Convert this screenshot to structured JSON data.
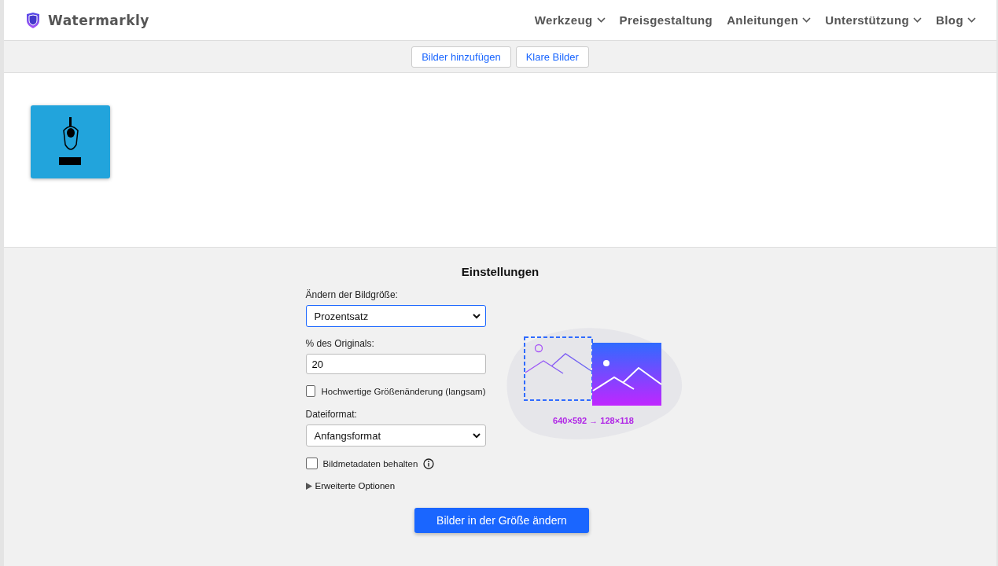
{
  "header": {
    "brand": "Watermarkly",
    "nav": [
      {
        "label": "Werkzeug",
        "dropdown": true
      },
      {
        "label": "Preisgestaltung",
        "dropdown": false
      },
      {
        "label": "Anleitungen",
        "dropdown": true
      },
      {
        "label": "Unterstützung",
        "dropdown": true
      },
      {
        "label": "Blog",
        "dropdown": true
      }
    ]
  },
  "toolbar": {
    "buttons": [
      "Bilder hinzufügen",
      "Klare Bilder"
    ]
  },
  "settings": {
    "title": "Einstellungen",
    "fields": [
      {
        "kind": "select",
        "label": "Ändern der Bildgröße:",
        "value": "Prozentsatz",
        "focused": true
      },
      {
        "kind": "input",
        "label": "% des Originals:",
        "value": "20"
      },
      {
        "kind": "checkbox",
        "label": "Hochwertige Größenänderung (langsam)",
        "checked": false
      },
      {
        "kind": "select",
        "label": "Dateiformat:",
        "value": "Anfangsformat",
        "focused": false
      },
      {
        "kind": "checkbox",
        "label": "Bildmetadaten behalten",
        "checked": false,
        "info": true
      },
      {
        "kind": "disclosure",
        "label": "Erweiterte Optionen",
        "expanded": false
      }
    ],
    "preview_caption": "640×592 → 128×118",
    "submit": "Bilder in der Größe ändern"
  }
}
